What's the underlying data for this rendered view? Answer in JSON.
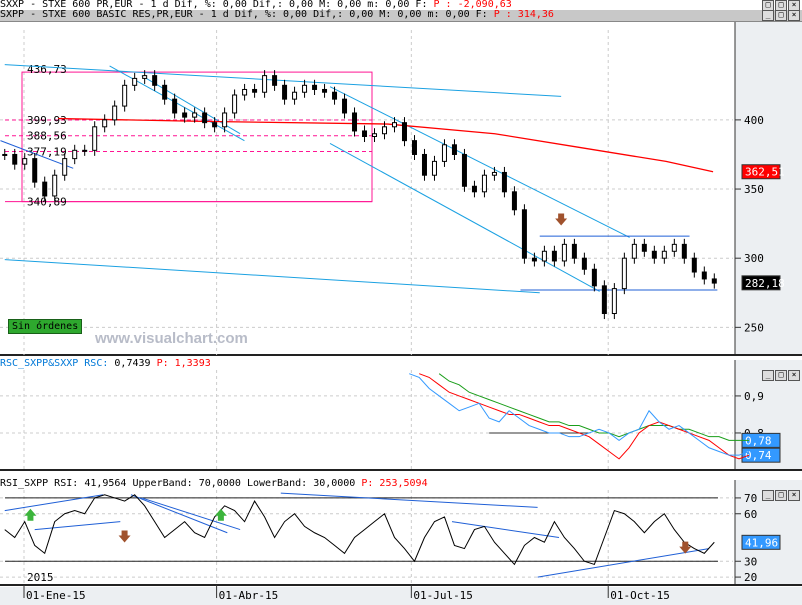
{
  "window": {
    "outer_title": {
      "symbol": "SXXP - STXE 600 PR,EUR -",
      "stats": "1 d Dif, %: 0,00 Dif,: 0,00 M: 0,00 m: 0,00 F:",
      "price": "P : -2,090,63"
    },
    "inner_title": {
      "symbol": "SXPP - STXE 600 BASIC RES,PR,EUR -",
      "stats": "1 d Dif, %: 0,00 Dif,: 0,00 M: 0,00 m: 0,00 F:",
      "price": "P : 314,36"
    },
    "buttons": {
      "minimize": "_",
      "maximize": "□",
      "close": "×"
    }
  },
  "watermark": "www.visualchart.com",
  "orders_badge": "Sin órdenes",
  "colors": {
    "accent_red": "#ff0000",
    "cyan": "#1ba1e2",
    "blue": "#1f5fd6",
    "magenta": "#ff1493",
    "green": "#1a9e1a",
    "rsc_blue": "#3399ff"
  },
  "chart_data": [
    {
      "type": "candlestick",
      "title": "SXPP - STXE 600 BASIC RES,PR,EUR",
      "x_unit": "days from 01-Ene-15",
      "x_start": -9,
      "x_step": 4.67,
      "closes": [
        375,
        368,
        372,
        355,
        345,
        360,
        372,
        378,
        378,
        395,
        400,
        410,
        425,
        430,
        432,
        425,
        415,
        405,
        402,
        405,
        398,
        395,
        405,
        418,
        422,
        420,
        432,
        425,
        415,
        420,
        425,
        422,
        420,
        415,
        405,
        392,
        388,
        390,
        395,
        398,
        385,
        375,
        360,
        370,
        382,
        375,
        352,
        348,
        360,
        362,
        348,
        335,
        300,
        298,
        305,
        298,
        310,
        300,
        292,
        280,
        260,
        278,
        300,
        310,
        305,
        300,
        305,
        310,
        300,
        290,
        285,
        282
      ],
      "ma": {
        "name": "MA",
        "points": [
          [
            16,
            401
          ],
          [
            80,
            399
          ],
          [
            170,
            397
          ],
          [
            220,
            390
          ],
          [
            260,
            380
          ],
          [
            300,
            370
          ],
          [
            322,
            362.5
          ]
        ]
      },
      "levels": [
        {
          "label": "436,73",
          "value": 436.73
        },
        {
          "label": "399,93",
          "value": 399.93
        },
        {
          "label": "388,56",
          "value": 388.56
        },
        {
          "label": "377,19",
          "value": 377.19
        },
        {
          "label": "340,89",
          "value": 340.89
        }
      ],
      "trendlines": [
        {
          "color": "cyan",
          "from": [
            -9,
            440
          ],
          "to": [
            251,
            417
          ]
        },
        {
          "color": "cyan",
          "from": [
            40,
            439
          ],
          "to": [
            103,
            385
          ]
        },
        {
          "color": "cyan",
          "from": [
            55,
            432
          ],
          "to": [
            101,
            390
          ]
        },
        {
          "color": "cyan",
          "from": [
            143,
            424
          ],
          "to": [
            283,
            315
          ]
        },
        {
          "color": "cyan",
          "from": [
            143,
            383
          ],
          "to": [
            269,
            276
          ]
        },
        {
          "color": "cyan",
          "from": [
            -9,
            299
          ],
          "to": [
            241,
            275
          ]
        },
        {
          "color": "blue",
          "from": [
            241,
            316
          ],
          "to": [
            311,
            316
          ]
        },
        {
          "color": "blue",
          "from": [
            232,
            277
          ],
          "to": [
            324,
            277
          ]
        },
        {
          "color": "blue",
          "from": [
            -11,
            385
          ],
          "to": [
            23,
            365
          ]
        }
      ],
      "arrows": [
        {
          "dir": "down",
          "x": 251,
          "price": 320
        }
      ],
      "yaxis": {
        "ticks": [
          250,
          300,
          350,
          400
        ],
        "tick_labels": [
          "250",
          "300",
          "350",
          "400"
        ],
        "range": [
          230,
          465
        ]
      },
      "price_tags": [
        {
          "label": "362,51",
          "value": 362.51,
          "color": "#ff0000"
        },
        {
          "label": "282,18",
          "value": 282.18,
          "color": "#000000"
        }
      ]
    },
    {
      "type": "line",
      "title": "RSC_SXPP&SXXP",
      "header": {
        "name": "RSC_SXPP&SXXP RSC:",
        "value": "0,7439",
        "price": "P: 1,3393"
      },
      "x_start": 180,
      "x_step": 4.67,
      "series": [
        {
          "name": "RSC",
          "color": "#3399ff",
          "values": [
            0.96,
            0.95,
            0.92,
            0.9,
            0.88,
            0.86,
            0.87,
            0.88,
            0.84,
            0.83,
            0.86,
            0.84,
            0.82,
            0.81,
            0.8,
            0.8,
            0.79,
            0.79,
            0.8,
            0.81,
            0.8,
            0.78,
            0.8,
            0.81,
            0.86,
            0.83,
            0.81,
            0.82,
            0.8,
            0.78,
            0.76,
            0.75,
            0.74,
            0.74,
            0.75
          ]
        },
        {
          "name": "MA fast",
          "color": "#ff0000",
          "values": [
            null,
            0.96,
            0.95,
            0.93,
            0.91,
            0.9,
            0.89,
            0.88,
            0.87,
            0.86,
            0.85,
            0.85,
            0.84,
            0.83,
            0.82,
            0.82,
            0.81,
            0.8,
            0.79,
            0.77,
            0.75,
            0.73,
            0.76,
            0.8,
            0.82,
            0.83,
            0.82,
            0.81,
            0.8,
            0.79,
            0.78,
            0.76,
            0.74,
            0.73,
            0.74
          ]
        },
        {
          "name": "MA slow",
          "color": "#1a9e1a",
          "values": [
            null,
            null,
            null,
            0.96,
            0.94,
            0.93,
            0.91,
            0.9,
            0.89,
            0.88,
            0.87,
            0.86,
            0.85,
            0.84,
            0.83,
            0.83,
            0.82,
            0.82,
            0.81,
            0.8,
            0.8,
            0.79,
            0.8,
            0.81,
            0.82,
            0.82,
            0.82,
            0.81,
            0.81,
            0.8,
            0.79,
            0.79,
            0.78,
            0.78,
            0.78
          ]
        }
      ],
      "level": 0.8,
      "yaxis": {
        "ticks": [
          0.8,
          0.9
        ],
        "tick_labels": [
          "0,8",
          "0,9"
        ],
        "range": [
          0.7,
          0.97
        ]
      },
      "price_tags": [
        {
          "label": "0,78",
          "value": 0.78
        },
        {
          "label": "0,74",
          "value": 0.74
        }
      ]
    },
    {
      "type": "line",
      "title": "RSI_SXPP",
      "header": {
        "name": "RSI_SXPP RSI:",
        "value": "41,9564",
        "upper": "UpperBand:",
        "upper_value": "70,0000",
        "lower": "LowerBand:",
        "lower_value": "30,0000",
        "price": "P: 253,5094"
      },
      "x_start": -9,
      "x_step": 4.67,
      "values": [
        50,
        45,
        55,
        40,
        35,
        55,
        60,
        62,
        60,
        70,
        72,
        70,
        68,
        72,
        65,
        55,
        45,
        50,
        55,
        48,
        45,
        58,
        65,
        62,
        55,
        68,
        58,
        45,
        55,
        60,
        52,
        48,
        45,
        40,
        35,
        45,
        50,
        55,
        60,
        45,
        38,
        30,
        45,
        55,
        58,
        40,
        38,
        50,
        52,
        42,
        35,
        28,
        40,
        45,
        42,
        55,
        45,
        38,
        30,
        28,
        45,
        62,
        60,
        55,
        48,
        55,
        60,
        50,
        42,
        38,
        35,
        42
      ],
      "bands": [
        70,
        30
      ],
      "arrows": [
        {
          "dir": "up",
          "x": 3,
          "value": 60
        },
        {
          "dir": "down",
          "x": 47,
          "value": 45
        },
        {
          "dir": "up",
          "x": 92,
          "value": 60
        },
        {
          "dir": "down",
          "x": 309,
          "value": 38
        }
      ],
      "yaxis": {
        "ticks": [
          20,
          30,
          60,
          70
        ],
        "tick_labels": [
          "20",
          "30",
          "60",
          "70"
        ],
        "range": [
          15,
          75
        ]
      },
      "price_tags": [
        {
          "label": "41,96",
          "value": 41.96,
          "color": "#3399ff"
        }
      ],
      "year_label": "2015"
    }
  ],
  "xaxis": {
    "ticks": [
      0,
      90,
      181,
      273
    ],
    "tick_labels": [
      "01-Ene-15",
      "01-Abr-15",
      "01-Jul-15",
      "01-Oct-15"
    ]
  }
}
